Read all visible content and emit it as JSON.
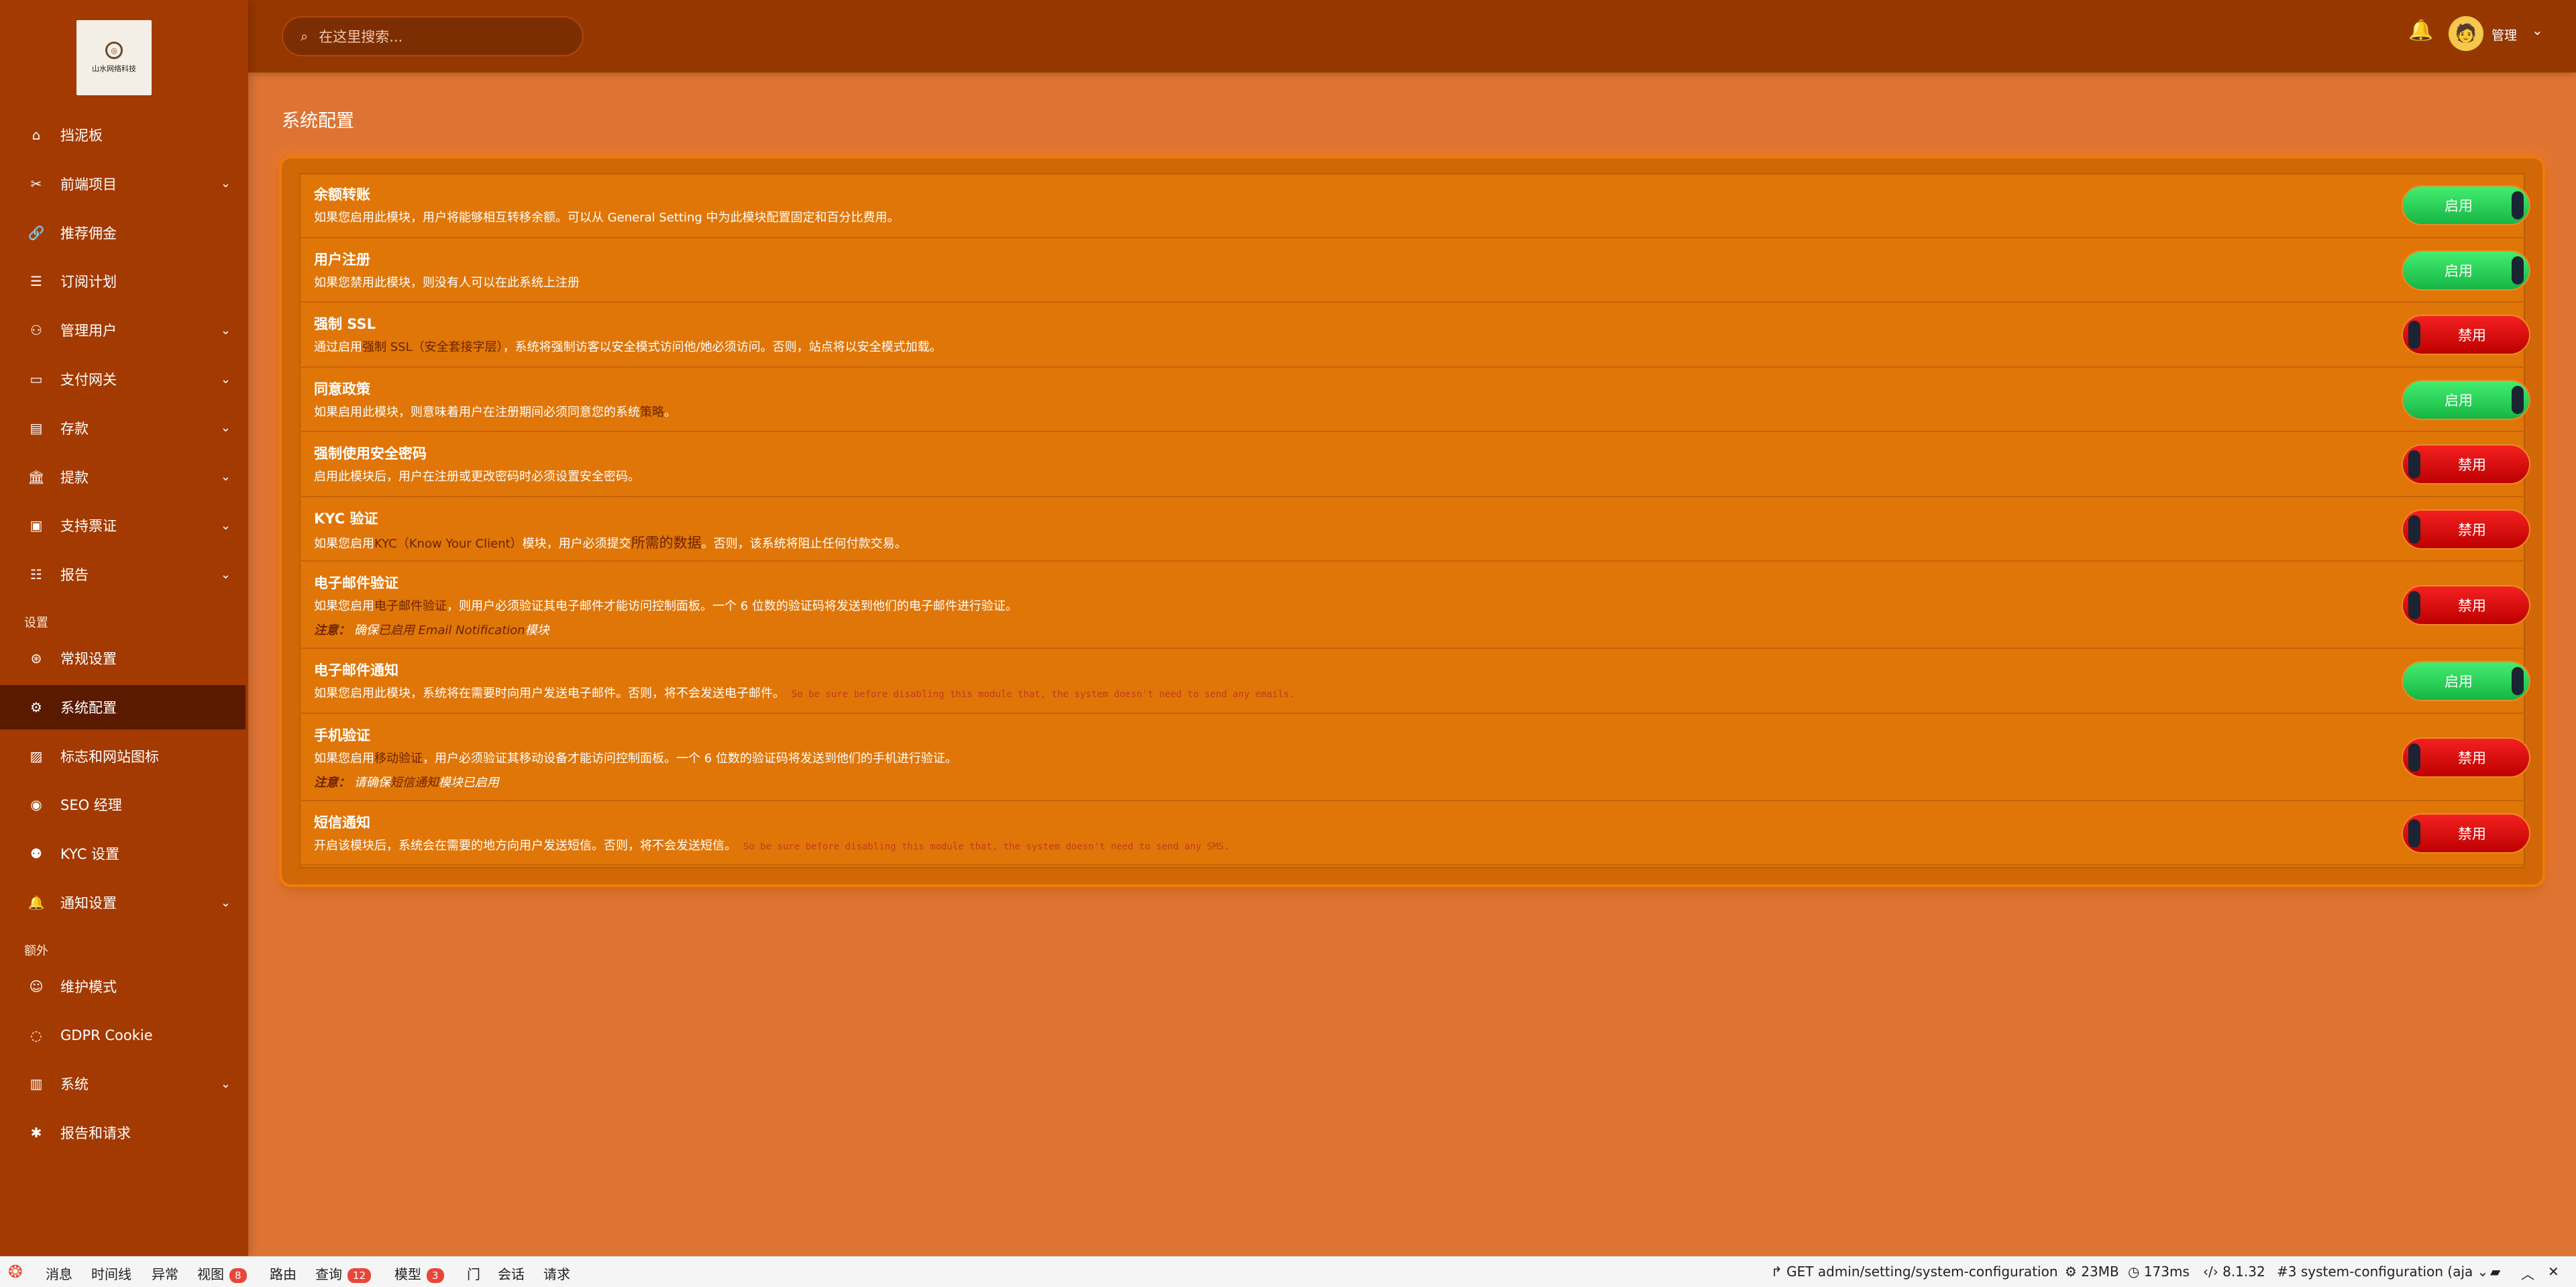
{
  "logo": {
    "text": "山水网络科技",
    "icon": "seal-icon"
  },
  "search": {
    "placeholder": "在这里搜索..."
  },
  "user": {
    "name": "管理"
  },
  "nav": {
    "items": [
      {
        "label": "挡泥板",
        "icon": "home-icon",
        "chev": ""
      },
      {
        "label": "前端项目",
        "icon": "tools-icon",
        "chev": "⌄"
      },
      {
        "label": "推荐佣金",
        "icon": "link-icon",
        "chev": ""
      },
      {
        "label": "订阅计划",
        "icon": "list-icon",
        "chev": ""
      },
      {
        "label": "管理用户",
        "icon": "users-icon",
        "chev": "⌄"
      },
      {
        "label": "支付网关",
        "icon": "card-icon",
        "chev": "⌄"
      },
      {
        "label": "存款",
        "icon": "deposit-icon",
        "chev": "⌄"
      },
      {
        "label": "提款",
        "icon": "bank-icon",
        "chev": "⌄"
      },
      {
        "label": "支持票证",
        "icon": "ticket-icon",
        "chev": "⌄"
      },
      {
        "label": "报告",
        "icon": "report-icon",
        "chev": "⌄"
      }
    ],
    "section_settings": "设置",
    "settings_items": [
      {
        "label": "常规设置",
        "icon": "life-ring-icon",
        "chev": ""
      },
      {
        "label": "系统配置",
        "icon": "gear-icon",
        "chev": ""
      },
      {
        "label": "标志和网站图标",
        "icon": "image-icon",
        "chev": ""
      },
      {
        "label": "SEO 经理",
        "icon": "globe-icon",
        "chev": ""
      },
      {
        "label": "KYC 设置",
        "icon": "user-check-icon",
        "chev": ""
      },
      {
        "label": "通知设置",
        "icon": "bell-icon",
        "chev": "⌄"
      }
    ],
    "section_extra": "额外",
    "extra_items": [
      {
        "label": "维护模式",
        "icon": "robot-icon",
        "chev": ""
      },
      {
        "label": "GDPR Cookie",
        "icon": "cookie-icon",
        "chev": ""
      },
      {
        "label": "系统",
        "icon": "server-icon",
        "chev": "⌄"
      },
      {
        "label": "报告和请求",
        "icon": "bug-icon",
        "chev": ""
      }
    ]
  },
  "page": {
    "title": "系统配置"
  },
  "rows": [
    {
      "title": "余额转账",
      "desc_a": "如果您启用此模块，用户将能够相互转移余额。可以从 General Setting 中为此模块配置固定和百分比费用",
      "desc_hl": "",
      "desc_b": "。",
      "on": true,
      "toggle": "启用"
    },
    {
      "title": "用户注册",
      "desc_a": "如果您禁用此模块，则没有人可以在此系统上注册",
      "desc_hl": "",
      "desc_b": "",
      "on": true,
      "toggle": "启用"
    },
    {
      "title": "强制 SSL",
      "desc_a": "通过启用",
      "desc_hl": "强制 SSL（安全套接字层）",
      "desc_b": "，系统将强制访客以安全模式访问他/她必须访问。否则，站点将以安全模式加载。",
      "on": false,
      "toggle": "禁用"
    },
    {
      "title": "同意政策",
      "desc_a": "如果启用此模块，则意味着用户在注册期间必须同意您的系统",
      "desc_hl": "策略",
      "desc_b": "。",
      "on": true,
      "toggle": "启用"
    },
    {
      "title": "强制使用安全密码",
      "desc_a": "启用此模块后，用户在注册或更改密码时必须设置安全密码。",
      "desc_hl": "",
      "desc_b": "",
      "on": false,
      "toggle": "禁用"
    },
    {
      "title": "KYC 验证",
      "desc_a": "如果您启用",
      "desc_hl": "KYC（Know Your Client）",
      "desc_b": "模块，用户必须提交",
      "desc_hl2": "所需的数据",
      "desc_c": "。否则，该系统将阻止任何付款交易。",
      "on": false,
      "toggle": "禁用"
    },
    {
      "title": "电子邮件验证",
      "desc_a": "如果您启用",
      "desc_hl": "电子邮件验证",
      "desc_b": "，则用户必须验证其电子邮件才能访问控制面板。一个 6 位数的验证码将发送到他们的电子邮件进行验证。",
      "note_label": "注意：",
      "note_a": "确保",
      "note_hl": "已启用 Email Notification",
      "note_b": "模块",
      "on": false,
      "toggle": "禁用"
    },
    {
      "title": "电子邮件通知",
      "desc_a": "如果您启用此模块，系统将在需要时向用户发送电子邮件。否则，将不会发送电子邮件。",
      "desc_hl": "",
      "desc_b": "",
      "mono": "So be sure before disabling this module that, the system doesn't need to send any emails.",
      "on": true,
      "toggle": "启用"
    },
    {
      "title": "手机验证",
      "desc_a": "如果您启用",
      "desc_hl": "移动验证",
      "desc_b": "，用户必须验证其移动设备才能访问控制面板。一个 6 位数的验证码将发送到他们的手机进行验证。",
      "note_label": "注意：",
      "note_a": "请确保",
      "note_hl": "短信通知",
      "note_b": "模块已启用",
      "on": false,
      "toggle": "禁用"
    },
    {
      "title": "短信通知",
      "desc_a": "开启该模块后，系统会在需要的地方向用户发送短信。否则，将不会发送短信。",
      "desc_hl": "",
      "desc_b": "",
      "mono": "So be sure before disabling this module that, the system doesn't need to send any SMS.",
      "on": false,
      "toggle": "禁用"
    }
  ],
  "debugbar": {
    "items": [
      {
        "label": "消息",
        "badge": ""
      },
      {
        "label": "时间线",
        "badge": ""
      },
      {
        "label": "异常",
        "badge": ""
      },
      {
        "label": "视图",
        "badge": "8"
      },
      {
        "label": "路由",
        "badge": ""
      },
      {
        "label": "查询",
        "badge": "12"
      },
      {
        "label": "模型",
        "badge": "3"
      },
      {
        "label": "门",
        "badge": ""
      },
      {
        "label": "会话",
        "badge": ""
      },
      {
        "label": "请求",
        "badge": ""
      }
    ],
    "route": "GET admin/setting/system-configuration",
    "memory": "23MB",
    "time": "173ms",
    "php": "8.1.32",
    "request": "#3 system-configuration (aja"
  },
  "colors": {
    "sidebar": "#a33a02",
    "topbar": "#963700",
    "content": "#de7434",
    "active": "#5a1a00",
    "on": "#2ad157",
    "off": "#d80000"
  }
}
